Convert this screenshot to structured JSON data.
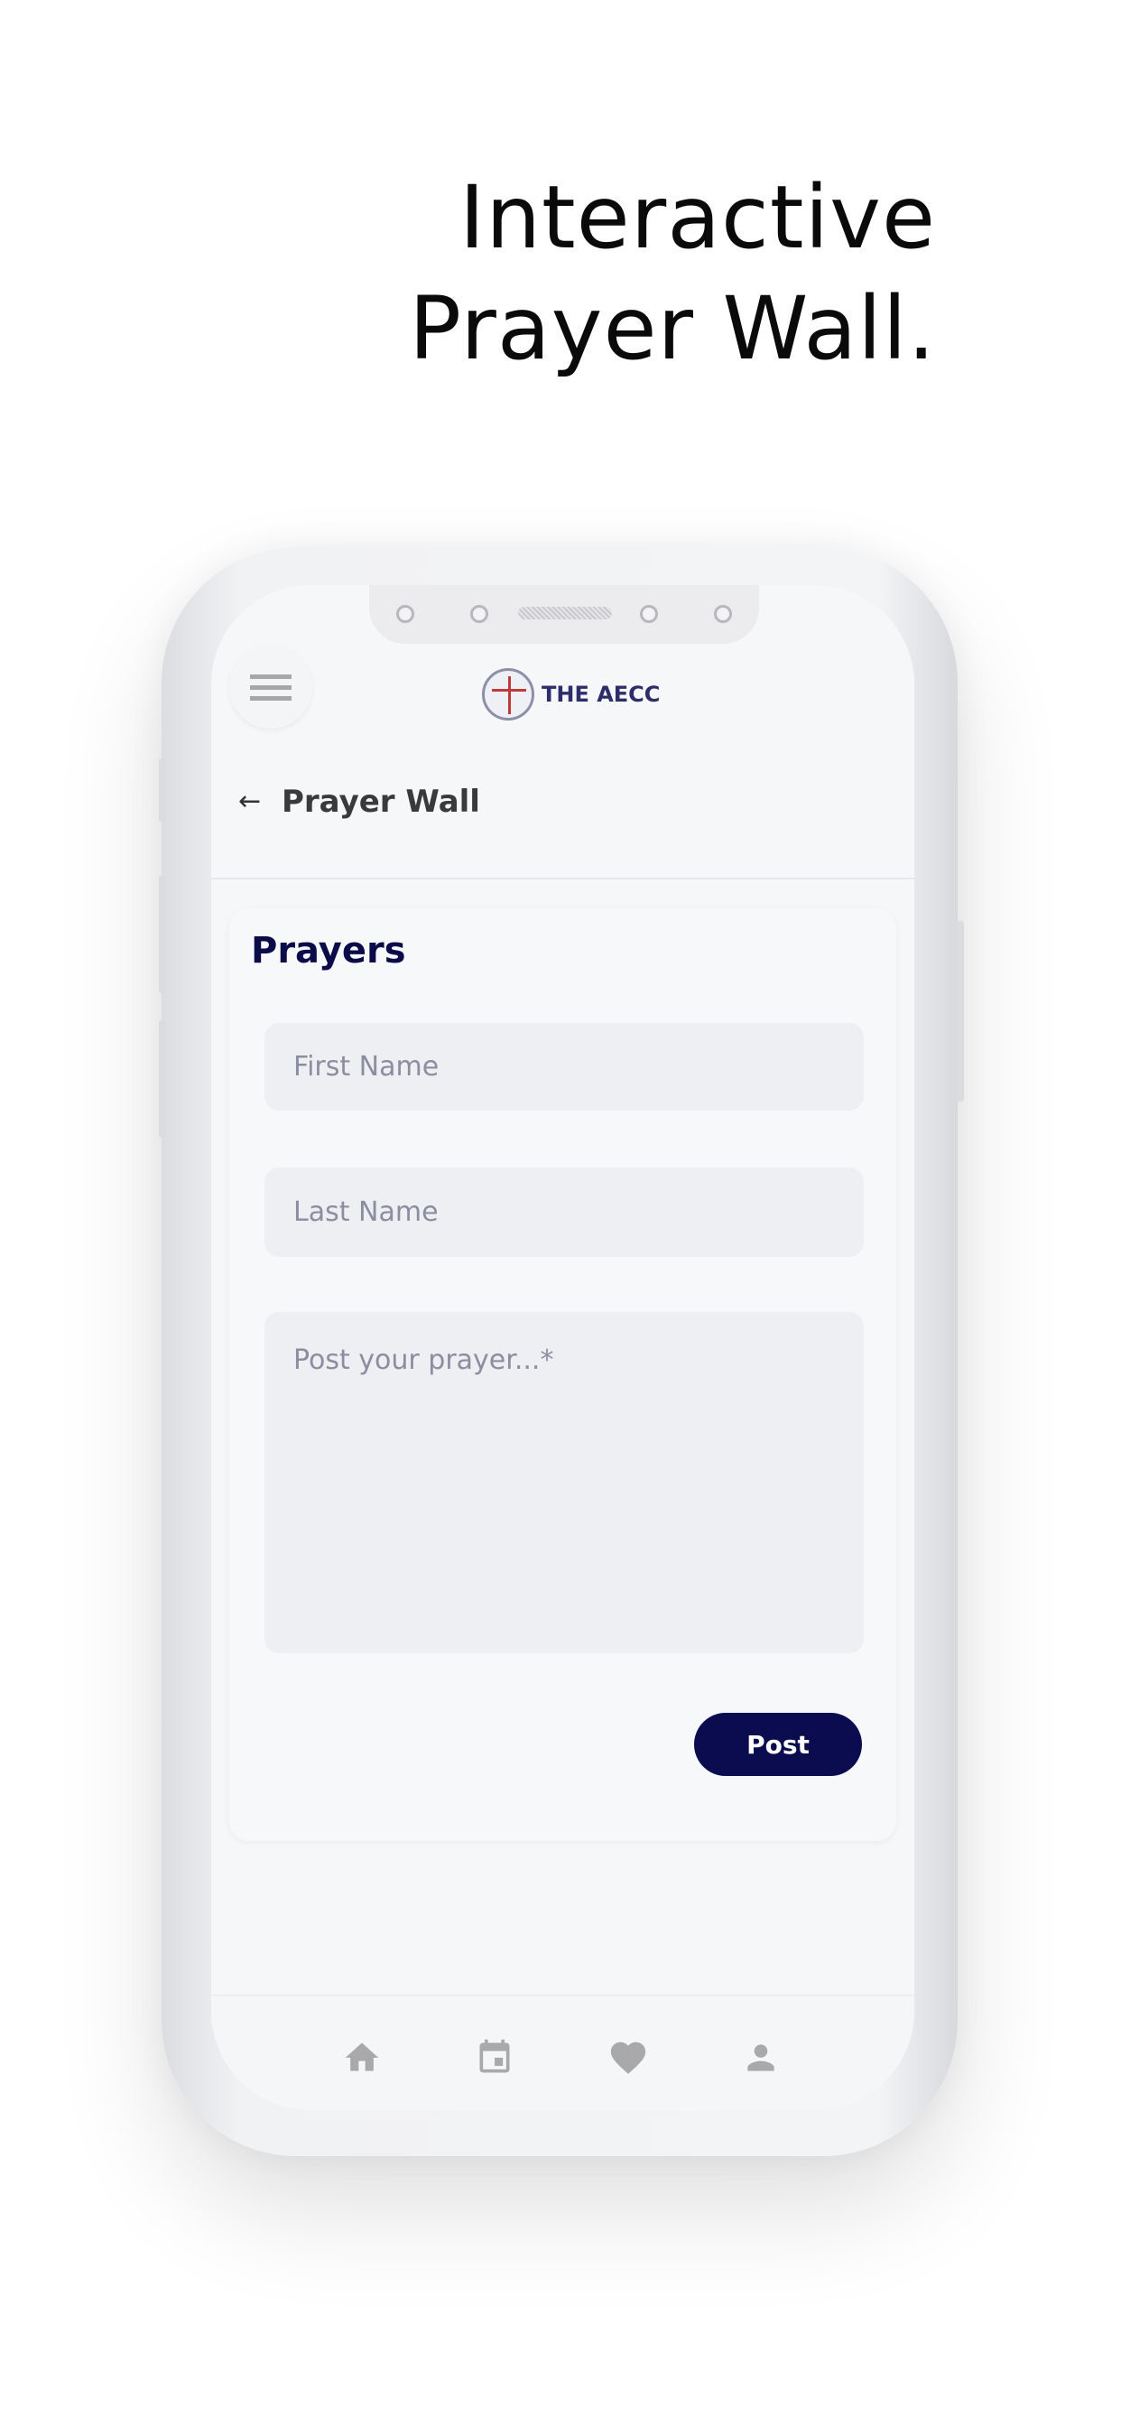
{
  "headline": {
    "line1": "Interactive",
    "line2": "Prayer Wall."
  },
  "app": {
    "logo_text": "THE AECC",
    "page_title": "Prayer Wall",
    "card": {
      "title": "Prayers",
      "first_name_placeholder": "First Name",
      "last_name_placeholder": "Last Name",
      "prayer_placeholder": "Post your prayer...*",
      "post_label": "Post"
    },
    "bottom_nav": [
      {
        "icon": "home-icon"
      },
      {
        "icon": "calendar-icon"
      },
      {
        "icon": "heart-icon"
      },
      {
        "icon": "person-icon"
      }
    ]
  },
  "colors": {
    "accent": "#0b0b50",
    "icon_gray": "#a9a9ac"
  }
}
